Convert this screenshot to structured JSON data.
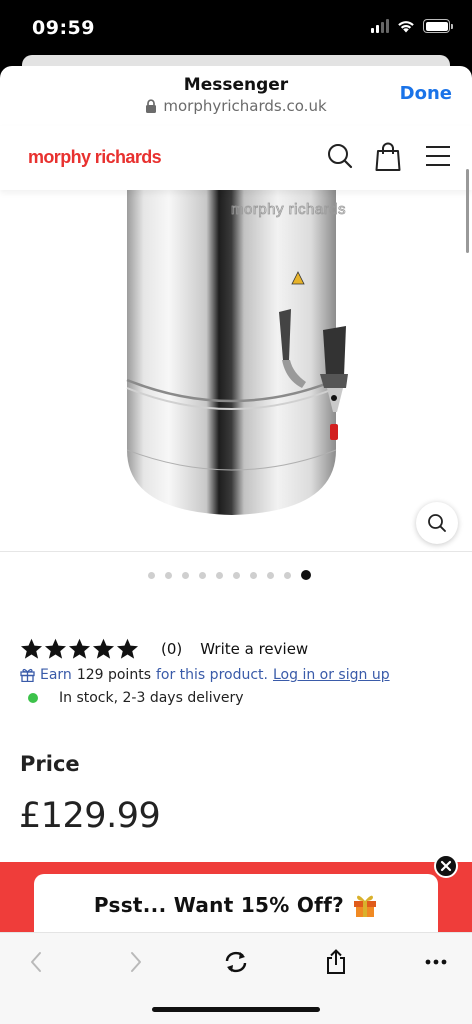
{
  "status_bar": {
    "time": "09:59",
    "icons": [
      "signal-icon",
      "wifi-icon",
      "battery-icon"
    ]
  },
  "sheet": {
    "title": "Messenger",
    "url": "morphyrichards.co.uk",
    "done_label": "Done"
  },
  "site": {
    "logo": "morphy richards",
    "brand_color": "#e8312f",
    "nav_icons": [
      "search-icon",
      "bag-icon",
      "menu-icon"
    ]
  },
  "product": {
    "image_brand_text": "morphy richards",
    "carousel_total": 10,
    "carousel_active_index": 9
  },
  "rating": {
    "stars": 5,
    "count": "(0)",
    "write_review": "Write a review"
  },
  "points": {
    "prefix": "Earn",
    "amount": "129 points",
    "middle": "for this product.",
    "link": "Log in or sign up"
  },
  "stock": {
    "text": "In stock, 2-3 days delivery",
    "color": "#3cc24a"
  },
  "price": {
    "label": "Price",
    "value": "£129.99"
  },
  "promo": {
    "text": "Psst... Want 15% Off?",
    "color": "#ef3d3a"
  },
  "toolbar": {
    "icons": [
      "back-icon",
      "forward-icon",
      "reload-icon",
      "share-icon",
      "more-icon"
    ]
  }
}
